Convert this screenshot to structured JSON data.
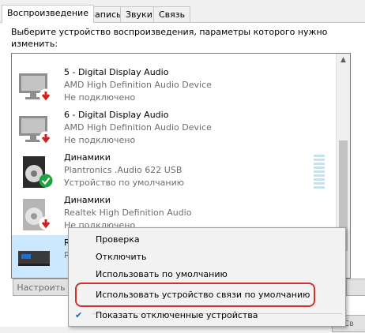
{
  "tabs": [
    {
      "label": "Воспроизведение",
      "active": true
    },
    {
      "label": "Запись",
      "active": false
    },
    {
      "label": "Звуки",
      "active": false
    },
    {
      "label": "Связь",
      "active": false
    }
  ],
  "description": "Выберите устройство воспроизведения, параметры которого нужно изменить:",
  "devices": [
    {
      "name": "5 - Digital Display Audio",
      "driver": "AMD High Definition Audio Device",
      "status": "Не подключено",
      "icon": "monitor-icon",
      "badge": "disconnected-badge-icon"
    },
    {
      "name": "6 - Digital Display Audio",
      "driver": "AMD High Definition Audio Device",
      "status": "Не подключено",
      "icon": "monitor-icon",
      "badge": "disconnected-badge-icon"
    },
    {
      "name": "Динамики",
      "driver": "Plantronics .Audio 622 USB",
      "status": "Устройство по умолчанию",
      "icon": "speaker-icon",
      "badge": "default-check-badge-icon"
    },
    {
      "name": "Динамики",
      "driver": "Realtek High Definition Audio",
      "status": "Не подключено",
      "icon": "speaker-icon",
      "badge": "disconnected-badge-icon"
    },
    {
      "name": "R",
      "driver": "R",
      "status": "",
      "icon": "receiver-icon",
      "badge": ""
    }
  ],
  "buttons": {
    "configure": "Настроить",
    "bottom_right": "Св"
  },
  "context_menu": [
    {
      "label": "Проверка",
      "checked": false
    },
    {
      "label": "Отключить",
      "checked": false
    },
    {
      "label": "Использовать по умолчанию",
      "checked": false
    },
    {
      "label": "Использовать устройство связи по умолчанию",
      "checked": false
    },
    {
      "label": "Показать отключенные устройства",
      "checked": true
    }
  ],
  "colors": {
    "selection": "#cce8ff",
    "check_green": "#1fa340",
    "disconnect_red": "#d01f1f",
    "highlight_ring": "#d03030"
  }
}
